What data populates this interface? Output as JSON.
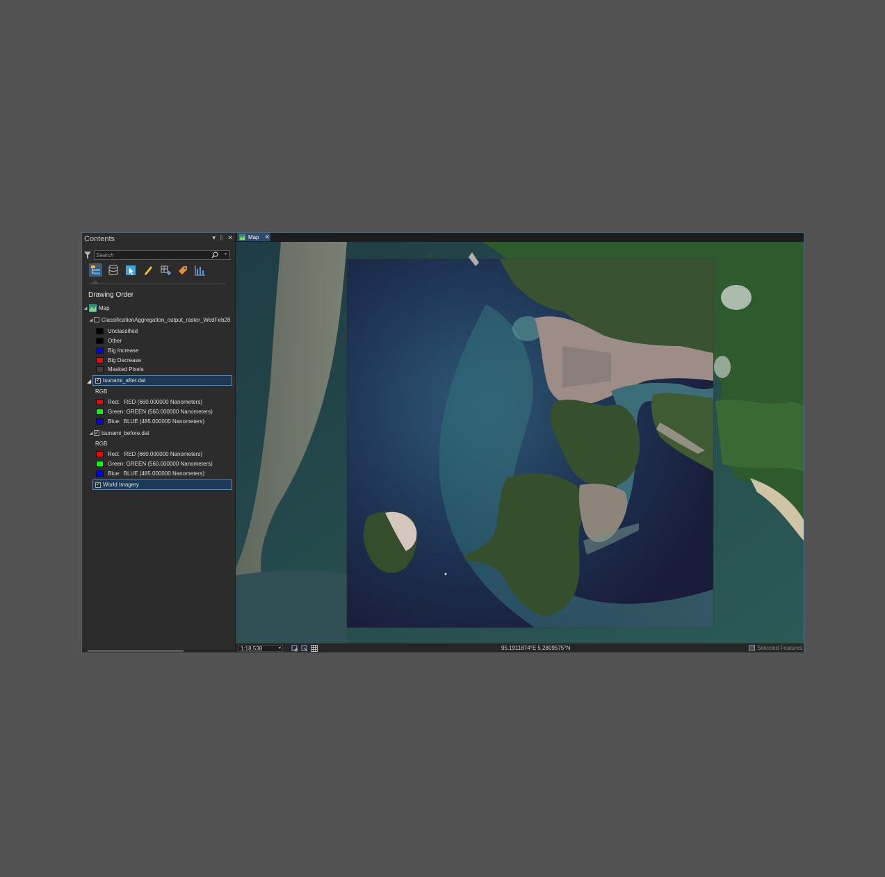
{
  "contents": {
    "title": "Contents",
    "controls": [
      "▾",
      "ᚱ",
      "✕"
    ],
    "search_placeholder": "Search",
    "section_title": "Drawing Order",
    "toolbar_icons": [
      "list-by-drawing-order-icon",
      "list-by-source-icon",
      "list-by-selection-icon",
      "list-by-editing-icon",
      "list-by-snapping-icon",
      "list-by-labeling-icon",
      "list-by-charts-icon"
    ],
    "map_label": "Map",
    "layers": {
      "classification": {
        "name": "ClassificationAggregation_output_raster_WedFeb28",
        "checked": false,
        "classes": [
          {
            "label": "Unclassified",
            "color": "#000000"
          },
          {
            "label": "Other",
            "color": "#000000"
          },
          {
            "label": "Big Increase",
            "color": "#0000ff"
          },
          {
            "label": "Big Decrease",
            "color": "#ff0000"
          },
          {
            "label": "Masked Pixels",
            "color": "#404040"
          }
        ]
      },
      "after": {
        "name": "tsunami_after.dat",
        "checked": true,
        "selected": true,
        "rgb_label": "RGB",
        "bands": [
          {
            "label": "Red:   RED (660.000000 Nanometers)",
            "color": "#ff0000"
          },
          {
            "label": "Green: GREEN (560.000000 Nanometers)",
            "color": "#00ff00"
          },
          {
            "label": "Blue:  BLUE (485.000000 Nanometers)",
            "color": "#0000ff"
          }
        ]
      },
      "before": {
        "name": "tsunami_before.dat",
        "checked": true,
        "rgb_label": "RGB",
        "bands": [
          {
            "label": "Red:   RED (660.000000 Nanometers)",
            "color": "#ff0000"
          },
          {
            "label": "Green: GREEN (560.000000 Nanometers)",
            "color": "#00ff00"
          },
          {
            "label": "Blue:  BLUE (485.000000 Nanometers)",
            "color": "#0000ff"
          }
        ]
      },
      "basemap": {
        "name": "World Imagery",
        "checked": true,
        "selected": true
      }
    }
  },
  "map": {
    "tab_label": "Map",
    "tab_close": "✕",
    "scale": "1:18,538",
    "coordinates": "95.1911874°E 5.2809575°N",
    "selected_features": "Selected Features"
  }
}
